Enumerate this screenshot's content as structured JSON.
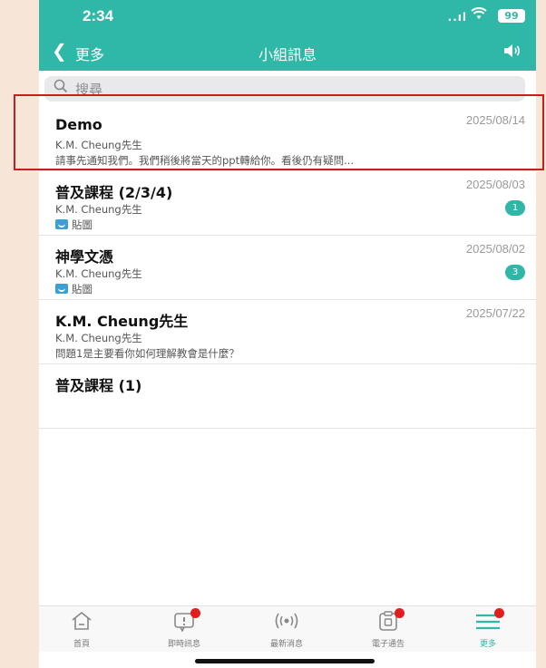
{
  "status": {
    "time": "2:34",
    "signal": "..ıl",
    "wifi": "◠",
    "battery": "99"
  },
  "header": {
    "back_icon": "❮",
    "back_label": "更多",
    "title": "小組訊息",
    "speaker_icon": "speaker-icon"
  },
  "search": {
    "placeholder": "搜尋"
  },
  "groups": [
    {
      "title": "Demo",
      "date": "2025/08/14",
      "sender": "K.M. Cheung先生",
      "preview": "請事先通知我們。我們稍後將當天的ppt轉給你。看後仍有疑問...",
      "badge": ""
    },
    {
      "title": "普及課程 (2/3/4)",
      "date": "2025/08/03",
      "sender": "K.M. Cheung先生",
      "preview": "貼圖",
      "badge": "1"
    },
    {
      "title": "神學文憑",
      "date": "2025/08/02",
      "sender": "K.M. Cheung先生",
      "preview": "貼圖",
      "badge": "3"
    },
    {
      "title": "K.M. Cheung先生",
      "date": "2025/07/22",
      "sender": "K.M. Cheung先生",
      "preview": "問題1是主要看你如何理解教會是什麼？",
      "badge": ""
    },
    {
      "title": "普及課程 (1)"
    }
  ],
  "tabs": [
    {
      "label": "首頁",
      "icon": "home-icon"
    },
    {
      "label": "即時訊息",
      "icon": "message-icon"
    },
    {
      "label": "最新消息",
      "icon": "broadcast-icon"
    },
    {
      "label": "電子通告",
      "icon": "notice-icon"
    },
    {
      "label": "更多",
      "icon": "menu-icon"
    }
  ],
  "colors": {
    "accent": "#2fb8a7",
    "alert": "#e21d1d",
    "highlight": "#c81e1e"
  }
}
